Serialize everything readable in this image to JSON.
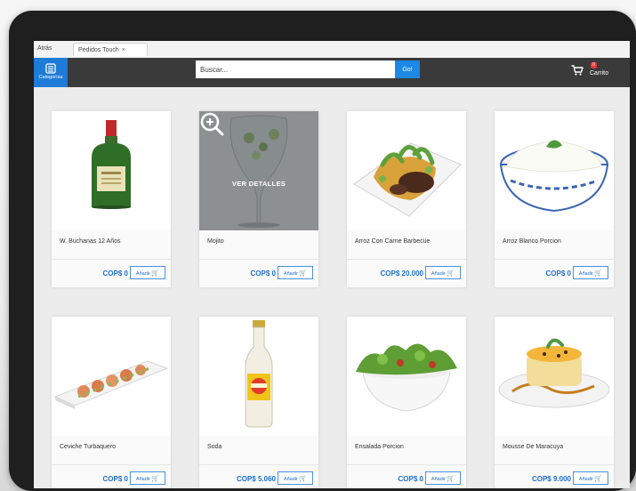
{
  "browser": {
    "back_label": "Atrás",
    "tab_label": "Pedidos Touch",
    "tab_close": "×"
  },
  "navbar": {
    "categories_label": "Categorías",
    "search_placeholder": "Buscar...",
    "go_label": "Go!",
    "cart_label": "Carrito",
    "cart_count": "0",
    "accent_color": "#1e7bd8",
    "bar_color": "#3a3a3a"
  },
  "product_actions": {
    "view_details": "VER DETALLES",
    "add_label": "Añadir",
    "cart_icon": "cart-icon"
  },
  "products": [
    {
      "name": "W. Buchanas 12 Años",
      "price": "COP$ 0"
    },
    {
      "name": "Mojito",
      "price": "COP$ 0"
    },
    {
      "name": "Arroz Con Carne Barbecue",
      "price": "COP$ 20.000"
    },
    {
      "name": "Arroz Blanco Porcion",
      "price": "COP$ 0"
    },
    {
      "name": "Ceviche Turbaquero",
      "price": "COP$ 0"
    },
    {
      "name": "Soda",
      "price": "COP$ 5.060"
    },
    {
      "name": "Ensalada Porcion",
      "price": "COP$ 0"
    },
    {
      "name": "Mousse De Maracuya",
      "price": "COP$ 9.000"
    }
  ]
}
